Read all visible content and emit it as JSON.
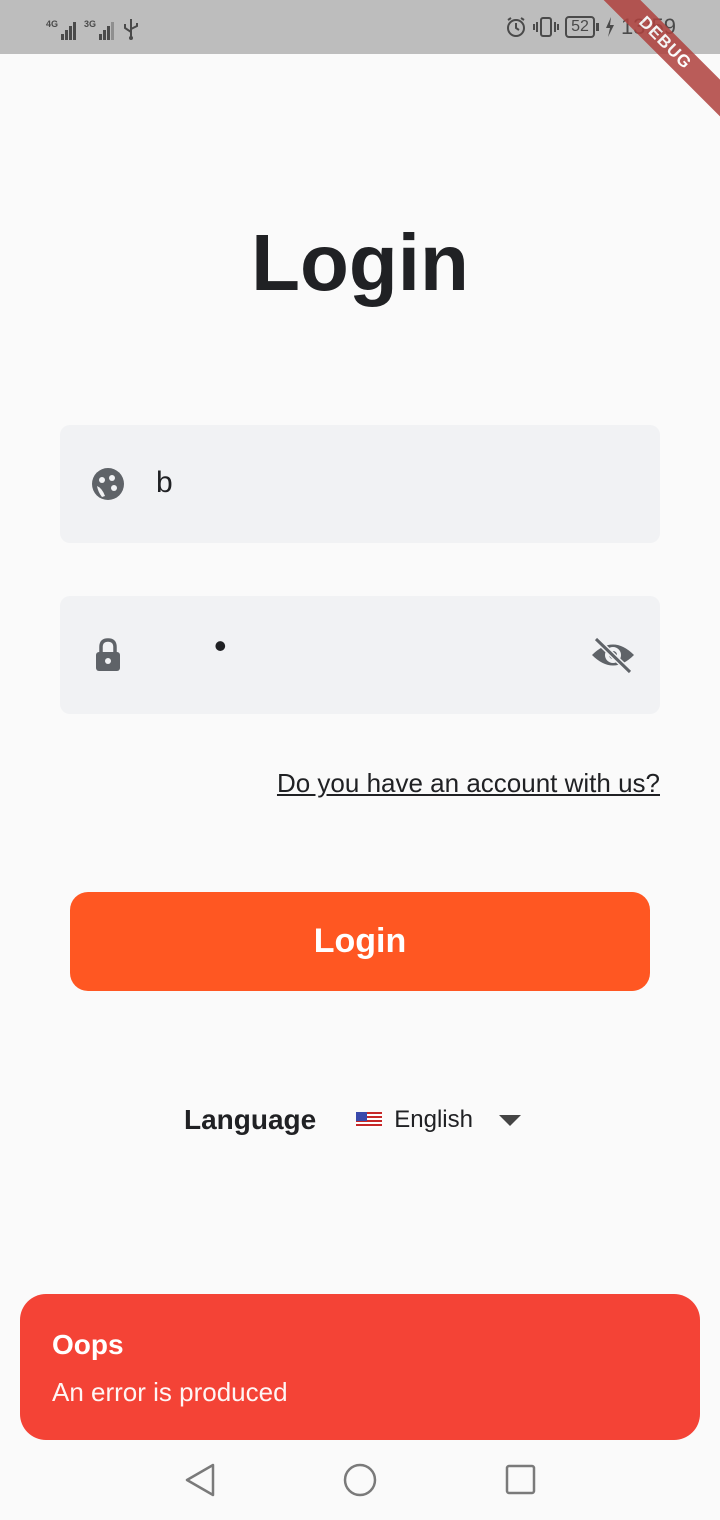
{
  "status_bar": {
    "network_1": "4G",
    "network_2": "3G",
    "battery_level": "52",
    "time": "13:59",
    "icons": [
      "signal-icon",
      "signal-icon",
      "usb-icon",
      "alarm-icon",
      "vibrate-icon",
      "battery-icon",
      "charging-icon"
    ]
  },
  "debug_banner": "DEBUG",
  "login": {
    "title": "Login",
    "username": {
      "value": "b",
      "icon": "face-icon"
    },
    "password": {
      "value": "•",
      "icon": "lock-icon",
      "toggle_icon": "visibility-off-icon"
    },
    "account_link": "Do you have an account with us?",
    "submit_label": "Login",
    "accent_color": "#FF5722"
  },
  "language": {
    "label": "Language",
    "selected": "English",
    "flag": "us-flag-icon"
  },
  "snackbar": {
    "title": "Oops",
    "message": "An error is produced",
    "color": "#F44336"
  },
  "nav_bar": {
    "icons": [
      "back-icon",
      "home-icon",
      "recents-icon"
    ]
  }
}
